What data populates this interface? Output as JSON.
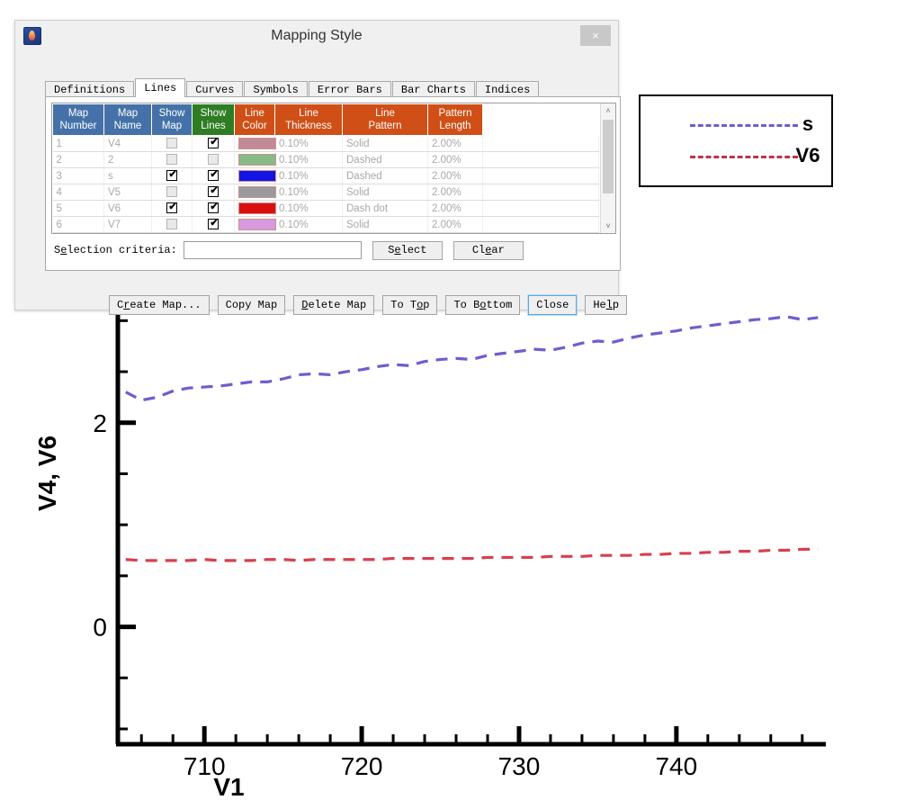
{
  "dialog": {
    "title": "Mapping Style",
    "app_icon": "flame-icon",
    "close_label": "×",
    "tabs": [
      {
        "label": "Definitions",
        "active": false
      },
      {
        "label": "Lines",
        "active": true
      },
      {
        "label": "Curves",
        "active": false
      },
      {
        "label": "Symbols",
        "active": false
      },
      {
        "label": "Error Bars",
        "active": false
      },
      {
        "label": "Bar Charts",
        "active": false
      },
      {
        "label": "Indices",
        "active": false
      }
    ],
    "table": {
      "columns": [
        {
          "label": "Map Number",
          "color": "#4472a8"
        },
        {
          "label": "Map Name",
          "color": "#4472a8"
        },
        {
          "label": "Show Map",
          "color": "#4472a8"
        },
        {
          "label": "Show Lines",
          "color": "#2e7d23"
        },
        {
          "label": "Line Color",
          "color": "#cf4f17"
        },
        {
          "label": "Line Thickness",
          "color": "#cf4f17"
        },
        {
          "label": "Line Pattern",
          "color": "#cf4f17"
        },
        {
          "label": "Pattern Length",
          "color": "#cf4f17"
        }
      ],
      "rows": [
        {
          "number": "1",
          "name": "V4",
          "show_map": false,
          "show_lines": true,
          "color": "#c08a96",
          "thickness": "0.10%",
          "pattern": "Solid",
          "pattern_length": "2.00%",
          "enabled": false
        },
        {
          "number": "2",
          "name": "2",
          "show_map": false,
          "show_lines": false,
          "color": "#86bb86",
          "thickness": "0.10%",
          "pattern": "Dashed",
          "pattern_length": "2.00%",
          "enabled": false
        },
        {
          "number": "3",
          "name": "s",
          "show_map": true,
          "show_lines": true,
          "color": "#1414e6",
          "thickness": "0.10%",
          "pattern": "Dashed",
          "pattern_length": "2.00%",
          "enabled": true
        },
        {
          "number": "4",
          "name": "V5",
          "show_map": false,
          "show_lines": true,
          "color": "#9a9a9a",
          "thickness": "0.10%",
          "pattern": "Solid",
          "pattern_length": "2.00%",
          "enabled": false
        },
        {
          "number": "5",
          "name": "V6",
          "show_map": true,
          "show_lines": true,
          "color": "#dc0f0f",
          "thickness": "0.10%",
          "pattern": "Dash dot",
          "pattern_length": "2.00%",
          "enabled": true
        },
        {
          "number": "6",
          "name": "V7",
          "show_map": false,
          "show_lines": true,
          "color": "#d79ade",
          "thickness": "0.10%",
          "pattern": "Solid",
          "pattern_length": "2.00%",
          "enabled": false
        }
      ]
    },
    "criteria": {
      "label": "Selection criteria:",
      "value": "",
      "placeholder": "",
      "select_label": "Select",
      "clear_label": "Clear"
    },
    "buttons": [
      {
        "label": "Create Map...",
        "focused": false
      },
      {
        "label": "Copy Map",
        "focused": false
      },
      {
        "label": "Delete Map",
        "focused": false
      },
      {
        "label": "To Top",
        "focused": false
      },
      {
        "label": "To Bottom",
        "focused": false
      },
      {
        "label": "Close",
        "focused": true
      },
      {
        "label": "Help",
        "focused": false
      }
    ],
    "scrollbar": {
      "up": "˄",
      "down": "˅"
    }
  },
  "legend": {
    "entries": [
      {
        "label": "s",
        "color": "#6b5fcf"
      },
      {
        "label": "V6",
        "color": "#b5384a"
      }
    ]
  },
  "chart_data": {
    "type": "line",
    "title": "",
    "xlabel": "V1",
    "ylabel": "V4, V6",
    "xlim": [
      704.5,
      749.5
    ],
    "ylim": [
      -1.15,
      3.1
    ],
    "xticks": [
      710,
      720,
      730,
      740
    ],
    "yticks": [
      0,
      2
    ],
    "x_minor_step": 2,
    "y_minor_step": 0.5,
    "grid": false,
    "legend_position": "outside-top-right",
    "series": [
      {
        "name": "s",
        "color": "#6b5fcf",
        "style": "dashed",
        "x": [
          705,
          706,
          707,
          708,
          709,
          710,
          711,
          712,
          713,
          714,
          715,
          716,
          717,
          718,
          719,
          720,
          721,
          722,
          723,
          724,
          725,
          726,
          727,
          728,
          729,
          730,
          731,
          732,
          733,
          734,
          735,
          736,
          737,
          738,
          739,
          740,
          741,
          742,
          743,
          744,
          745,
          746,
          747,
          748,
          749
        ],
        "y": [
          2.3,
          2.22,
          2.25,
          2.31,
          2.34,
          2.35,
          2.36,
          2.38,
          2.4,
          2.4,
          2.43,
          2.47,
          2.48,
          2.47,
          2.5,
          2.52,
          2.55,
          2.57,
          2.56,
          2.6,
          2.62,
          2.63,
          2.62,
          2.66,
          2.68,
          2.7,
          2.72,
          2.71,
          2.74,
          2.78,
          2.8,
          2.79,
          2.83,
          2.86,
          2.88,
          2.9,
          2.93,
          2.95,
          2.97,
          2.99,
          3.01,
          3.02,
          3.04,
          3.01,
          3.03
        ]
      },
      {
        "name": "V6",
        "color": "#d6404d",
        "style": "dashed",
        "x": [
          705,
          706,
          707,
          708,
          709,
          710,
          711,
          712,
          713,
          714,
          715,
          716,
          717,
          718,
          719,
          720,
          721,
          722,
          723,
          724,
          725,
          726,
          727,
          728,
          729,
          730,
          731,
          732,
          733,
          734,
          735,
          736,
          737,
          738,
          739,
          740,
          741,
          742,
          743,
          744,
          745,
          746,
          747,
          748,
          749
        ],
        "y": [
          0.66,
          0.65,
          0.65,
          0.65,
          0.65,
          0.66,
          0.65,
          0.65,
          0.65,
          0.66,
          0.66,
          0.65,
          0.66,
          0.66,
          0.66,
          0.66,
          0.66,
          0.67,
          0.67,
          0.67,
          0.67,
          0.67,
          0.67,
          0.68,
          0.68,
          0.68,
          0.68,
          0.69,
          0.69,
          0.69,
          0.7,
          0.7,
          0.7,
          0.71,
          0.71,
          0.72,
          0.72,
          0.73,
          0.73,
          0.74,
          0.74,
          0.75,
          0.75,
          0.76,
          0.76
        ]
      }
    ]
  }
}
